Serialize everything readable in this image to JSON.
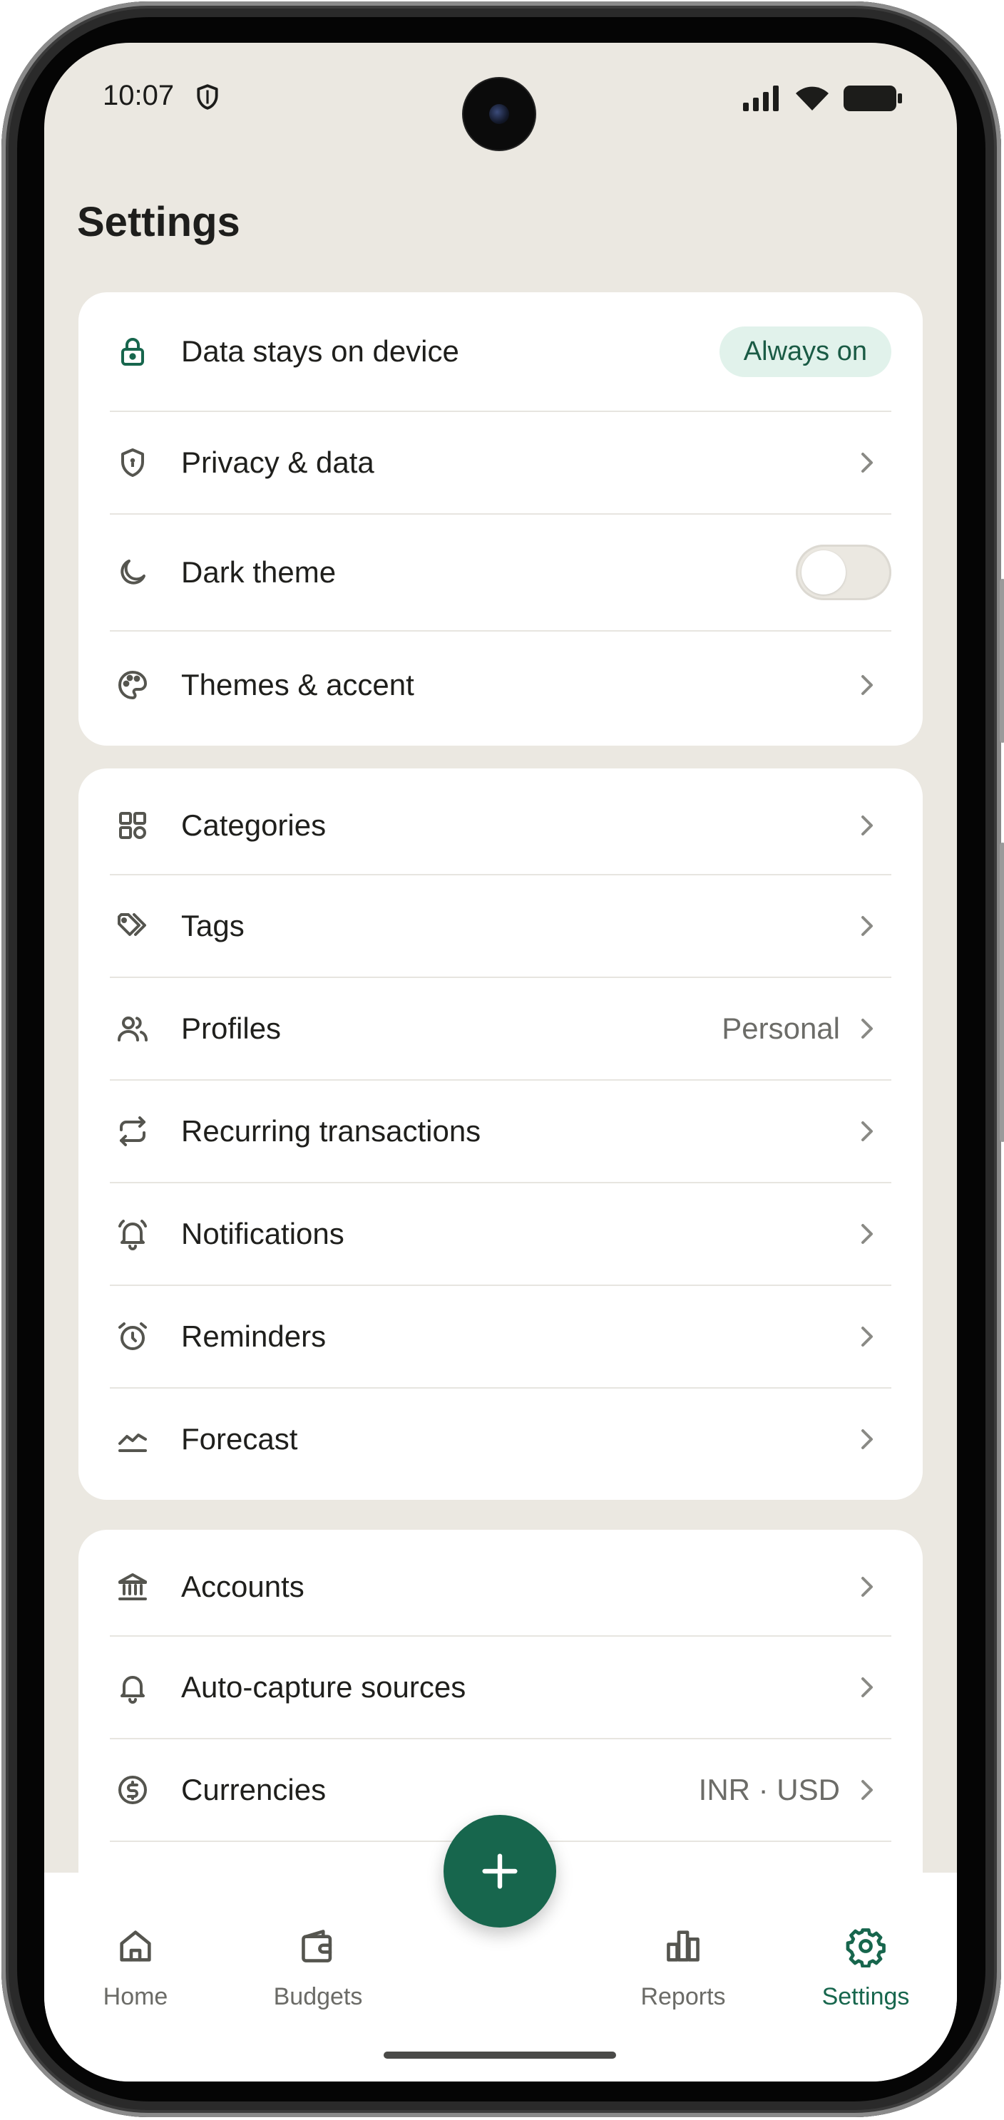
{
  "status_bar": {
    "time": "10:07"
  },
  "header": {
    "title": "Settings"
  },
  "group1": [
    {
      "name": "data-stays-on-device",
      "icon": "lock-icon",
      "label": "Data stays on device",
      "badge": "Always on"
    },
    {
      "name": "privacy-data",
      "icon": "shield-icon",
      "label": "Privacy & data"
    },
    {
      "name": "dark-theme",
      "icon": "moon-icon",
      "label": "Dark theme",
      "toggle_on": false
    },
    {
      "name": "themes-accent",
      "icon": "palette-icon",
      "label": "Themes & accent"
    }
  ],
  "group2": [
    {
      "name": "categories",
      "icon": "grid-icon",
      "label": "Categories"
    },
    {
      "name": "tags",
      "icon": "tags-icon",
      "label": "Tags"
    },
    {
      "name": "profiles",
      "icon": "users-icon",
      "label": "Profiles",
      "value": "Personal"
    },
    {
      "name": "recurring",
      "icon": "repeat-icon",
      "label": "Recurring transactions"
    },
    {
      "name": "notifications",
      "icon": "bell-ring-icon",
      "label": "Notifications"
    },
    {
      "name": "reminders",
      "icon": "alarm-icon",
      "label": "Reminders"
    },
    {
      "name": "forecast",
      "icon": "chart-line-icon",
      "label": "Forecast"
    }
  ],
  "group3": [
    {
      "name": "accounts",
      "icon": "bank-icon",
      "label": "Accounts"
    },
    {
      "name": "auto-capture",
      "icon": "bell-icon",
      "label": "Auto-capture sources"
    },
    {
      "name": "currencies",
      "icon": "dollar-circle-icon",
      "label": "Currencies",
      "value": "INR · USD"
    }
  ],
  "bottom_nav": {
    "items": [
      {
        "name": "home",
        "icon": "home-icon",
        "label": "Home",
        "active": false
      },
      {
        "name": "budgets",
        "icon": "wallet-icon",
        "label": "Budgets",
        "active": false
      },
      {
        "name": "reports",
        "icon": "bar-chart-icon",
        "label": "Reports",
        "active": false
      },
      {
        "name": "settings",
        "icon": "gear-icon",
        "label": "Settings",
        "active": true
      }
    ],
    "fab_icon": "plus-icon"
  },
  "colors": {
    "accent": "#17664d",
    "background": "#ebe8e1",
    "card": "#ffffff",
    "badge_bg": "#e1f2eb"
  }
}
